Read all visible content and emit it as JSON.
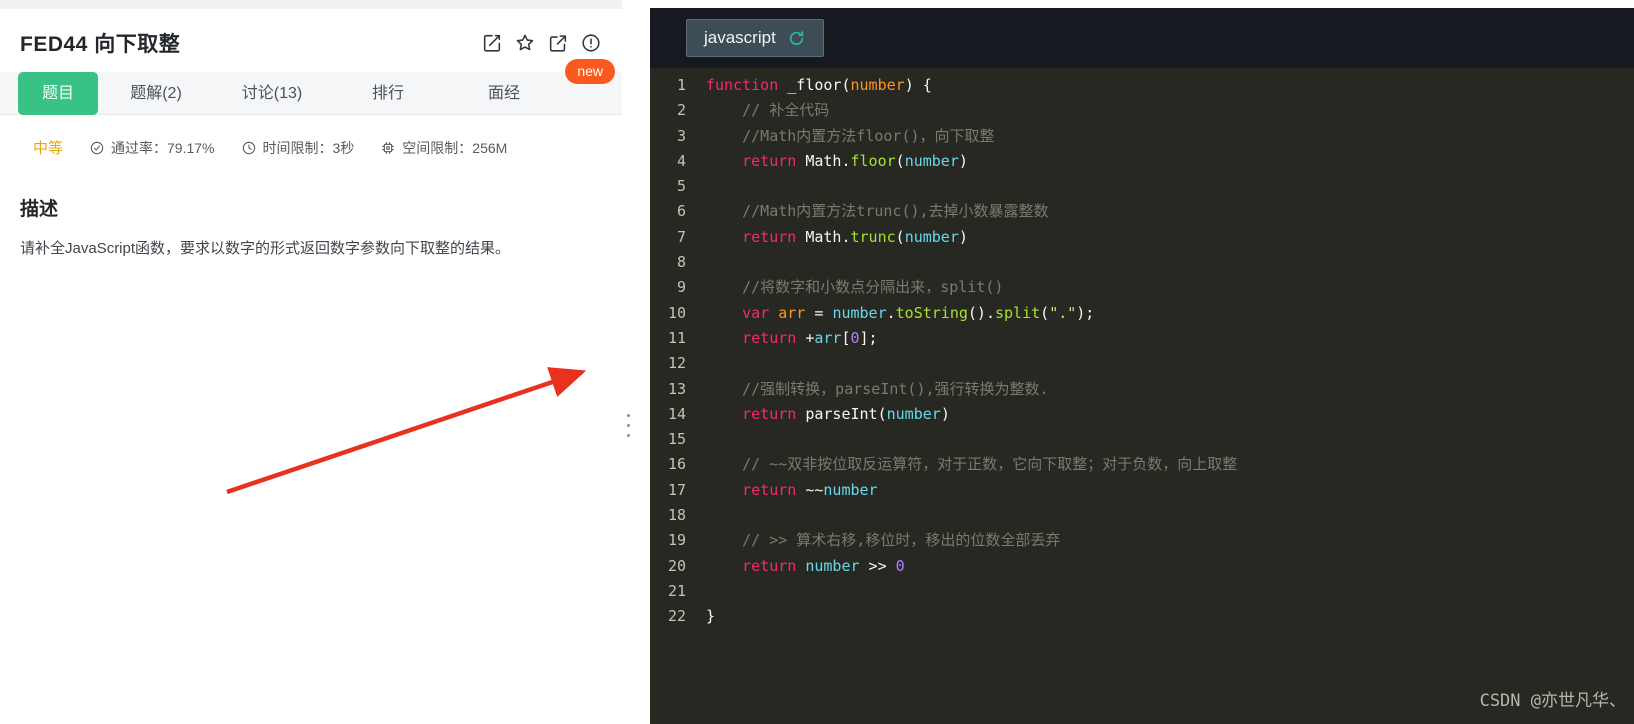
{
  "problem": {
    "title": "FED44 向下取整",
    "tabs": [
      {
        "label": "题目",
        "active": true
      },
      {
        "label": "题解(2)",
        "active": false
      },
      {
        "label": "讨论(13)",
        "active": false
      },
      {
        "label": "排行",
        "active": false
      },
      {
        "label": "面经",
        "active": false
      }
    ],
    "new_badge": "new",
    "difficulty": "中等",
    "meta": [
      {
        "icon": "check-circle-icon",
        "text": "通过率：79.17%"
      },
      {
        "icon": "clock-icon",
        "text": "时间限制：3秒"
      },
      {
        "icon": "chip-icon",
        "text": "空间限制：256M"
      }
    ],
    "section_title": "描述",
    "description": "请补全JavaScript函数，要求以数字的形式返回数字参数向下取整的结果。"
  },
  "editor": {
    "language": "javascript",
    "lines": [
      {
        "n": 1,
        "toks": [
          [
            "kw",
            "function"
          ],
          [
            "pl",
            " _floor("
          ],
          [
            "param",
            "number"
          ],
          [
            "pl",
            ") {"
          ]
        ]
      },
      {
        "n": 2,
        "toks": [
          [
            "pl",
            "    "
          ],
          [
            "cm",
            "// 补全代码"
          ]
        ]
      },
      {
        "n": 3,
        "toks": [
          [
            "pl",
            "    "
          ],
          [
            "cm",
            "//Math内置方法floor()，向下取整"
          ]
        ]
      },
      {
        "n": 4,
        "toks": [
          [
            "pl",
            "    "
          ],
          [
            "kw",
            "return"
          ],
          [
            "pl",
            " Math."
          ],
          [
            "fn",
            "floor"
          ],
          [
            "pl",
            "("
          ],
          [
            "var",
            "number"
          ],
          [
            "pl",
            ")"
          ]
        ]
      },
      {
        "n": 5,
        "toks": []
      },
      {
        "n": 6,
        "toks": [
          [
            "pl",
            "    "
          ],
          [
            "cm",
            "//Math内置方法trunc(),去掉小数暴露整数"
          ]
        ]
      },
      {
        "n": 7,
        "toks": [
          [
            "pl",
            "    "
          ],
          [
            "kw",
            "return"
          ],
          [
            "pl",
            " Math."
          ],
          [
            "fn",
            "trunc"
          ],
          [
            "pl",
            "("
          ],
          [
            "var",
            "number"
          ],
          [
            "pl",
            ")"
          ]
        ]
      },
      {
        "n": 8,
        "toks": []
      },
      {
        "n": 9,
        "toks": [
          [
            "pl",
            "    "
          ],
          [
            "cm",
            "//将数字和小数点分隔出来，split()"
          ]
        ]
      },
      {
        "n": 10,
        "toks": [
          [
            "pl",
            "    "
          ],
          [
            "kw",
            "var"
          ],
          [
            "pl",
            " "
          ],
          [
            "param",
            "arr"
          ],
          [
            "pl",
            " = "
          ],
          [
            "var",
            "number"
          ],
          [
            "pl",
            "."
          ],
          [
            "fn",
            "toString"
          ],
          [
            "pl",
            "()."
          ],
          [
            "fn",
            "split"
          ],
          [
            "pl",
            "("
          ],
          [
            "str",
            "\".\""
          ],
          [
            "pl",
            ");"
          ]
        ]
      },
      {
        "n": 11,
        "toks": [
          [
            "pl",
            "    "
          ],
          [
            "kw",
            "return"
          ],
          [
            "pl",
            " +"
          ],
          [
            "var",
            "arr"
          ],
          [
            "pl",
            "["
          ],
          [
            "num",
            "0"
          ],
          [
            "pl",
            "];"
          ]
        ]
      },
      {
        "n": 12,
        "toks": []
      },
      {
        "n": 13,
        "toks": [
          [
            "pl",
            "    "
          ],
          [
            "cm",
            "//强制转换，parseInt(),强行转换为整数."
          ]
        ]
      },
      {
        "n": 14,
        "toks": [
          [
            "pl",
            "    "
          ],
          [
            "kw",
            "return"
          ],
          [
            "pl",
            " parseInt("
          ],
          [
            "var",
            "number"
          ],
          [
            "pl",
            ")"
          ]
        ]
      },
      {
        "n": 15,
        "toks": []
      },
      {
        "n": 16,
        "toks": [
          [
            "pl",
            "    "
          ],
          [
            "cm",
            "// ~~双非按位取反运算符，对于正数，它向下取整；对于负数，向上取整"
          ]
        ]
      },
      {
        "n": 17,
        "toks": [
          [
            "pl",
            "    "
          ],
          [
            "kw",
            "return"
          ],
          [
            "pl",
            " ~~"
          ],
          [
            "var",
            "number"
          ]
        ]
      },
      {
        "n": 18,
        "toks": []
      },
      {
        "n": 19,
        "toks": [
          [
            "pl",
            "    "
          ],
          [
            "cm",
            "// >> 算术右移,移位时，移出的位数全部丢弃"
          ]
        ]
      },
      {
        "n": 20,
        "toks": [
          [
            "pl",
            "    "
          ],
          [
            "kw",
            "return"
          ],
          [
            "pl",
            " "
          ],
          [
            "var",
            "number"
          ],
          [
            "pl",
            " >> "
          ],
          [
            "num",
            "0"
          ]
        ]
      },
      {
        "n": 21,
        "toks": []
      },
      {
        "n": 22,
        "toks": [
          [
            "pl",
            "}"
          ]
        ]
      }
    ]
  },
  "watermark": "CSDN @亦世凡华、",
  "colors": {
    "accent_green": "#38c285",
    "badge_orange": "#fb5a1f",
    "difficulty_gold": "#e2a713",
    "arrow_red": "#e8321f",
    "editor_background": "#272822",
    "editor_header": "#161a20",
    "keyword_pink": "#f92672",
    "function_green": "#a6e22e",
    "param_orange": "#fd971f",
    "variable_cyan": "#66d9ef",
    "number_purple": "#ae81ff",
    "string_yellow": "#e6db74",
    "comment_gray": "#797b6e"
  }
}
